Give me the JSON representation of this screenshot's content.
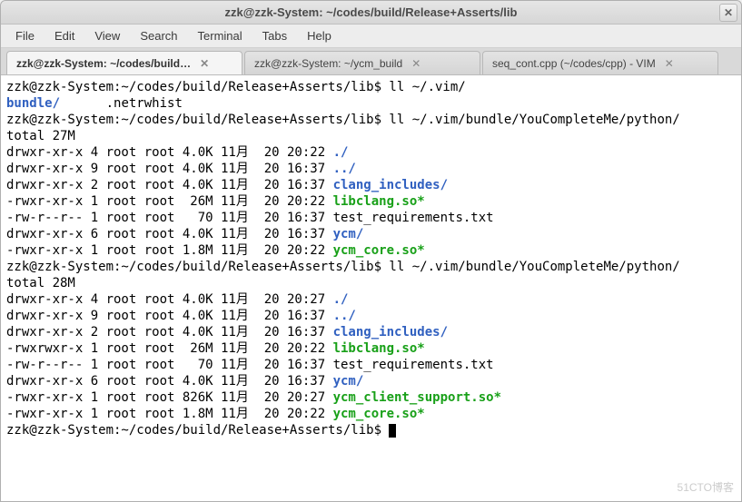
{
  "window": {
    "title": "zzk@zzk-System: ~/codes/build/Release+Asserts/lib"
  },
  "menu": [
    "File",
    "Edit",
    "View",
    "Search",
    "Terminal",
    "Tabs",
    "Help"
  ],
  "tabs": [
    {
      "title": "zzk@zzk-System: ~/codes/build…",
      "active": true
    },
    {
      "title": "zzk@zzk-System: ~/ycm_build",
      "active": false
    },
    {
      "title": "seq_cont.cpp (~/codes/cpp) - VIM",
      "active": false
    }
  ],
  "prompt_base": "zzk@zzk-System:~/codes/build/Release+Asserts/lib$ ",
  "commands": {
    "cmd1": "ll ~/.vim/",
    "cmd2": "ll ~/.vim/bundle/YouCompleteMe/python/",
    "cmd3": "ll ~/.vim/bundle/YouCompleteMe/python/"
  },
  "ls1_line": "bundle/      .netrwhist",
  "listing1": {
    "total": "total 27M",
    "rows": [
      {
        "meta": "drwxr-xr-x 4 root root 4.0K 11月  20 20:22 ",
        "name": "./",
        "type": "dir"
      },
      {
        "meta": "drwxr-xr-x 9 root root 4.0K 11月  20 16:37 ",
        "name": "../",
        "type": "dir"
      },
      {
        "meta": "drwxr-xr-x 2 root root 4.0K 11月  20 16:37 ",
        "name": "clang_includes/",
        "type": "dir"
      },
      {
        "meta": "-rwxr-xr-x 1 root root  26M 11月  20 20:22 ",
        "name": "libclang.so*",
        "type": "exe"
      },
      {
        "meta": "-rw-r--r-- 1 root root   70 11月  20 16:37 ",
        "name": "test_requirements.txt",
        "type": "file"
      },
      {
        "meta": "drwxr-xr-x 6 root root 4.0K 11月  20 16:37 ",
        "name": "ycm/",
        "type": "dir"
      },
      {
        "meta": "-rwxr-xr-x 1 root root 1.8M 11月  20 20:22 ",
        "name": "ycm_core.so*",
        "type": "exe"
      }
    ]
  },
  "listing2": {
    "total": "total 28M",
    "rows": [
      {
        "meta": "drwxr-xr-x 4 root root 4.0K 11月  20 20:27 ",
        "name": "./",
        "type": "dir"
      },
      {
        "meta": "drwxr-xr-x 9 root root 4.0K 11月  20 16:37 ",
        "name": "../",
        "type": "dir"
      },
      {
        "meta": "drwxr-xr-x 2 root root 4.0K 11月  20 16:37 ",
        "name": "clang_includes/",
        "type": "dir"
      },
      {
        "meta": "-rwxrwxr-x 1 root root  26M 11月  20 20:22 ",
        "name": "libclang.so*",
        "type": "exe"
      },
      {
        "meta": "-rw-r--r-- 1 root root   70 11月  20 16:37 ",
        "name": "test_requirements.txt",
        "type": "file"
      },
      {
        "meta": "drwxr-xr-x 6 root root 4.0K 11月  20 16:37 ",
        "name": "ycm/",
        "type": "dir"
      },
      {
        "meta": "-rwxr-xr-x 1 root root 826K 11月  20 20:27 ",
        "name": "ycm_client_support.so*",
        "type": "exe"
      },
      {
        "meta": "-rwxr-xr-x 1 root root 1.8M 11月  20 20:22 ",
        "name": "ycm_core.so*",
        "type": "exe"
      }
    ]
  },
  "watermark": "51CTO博客"
}
